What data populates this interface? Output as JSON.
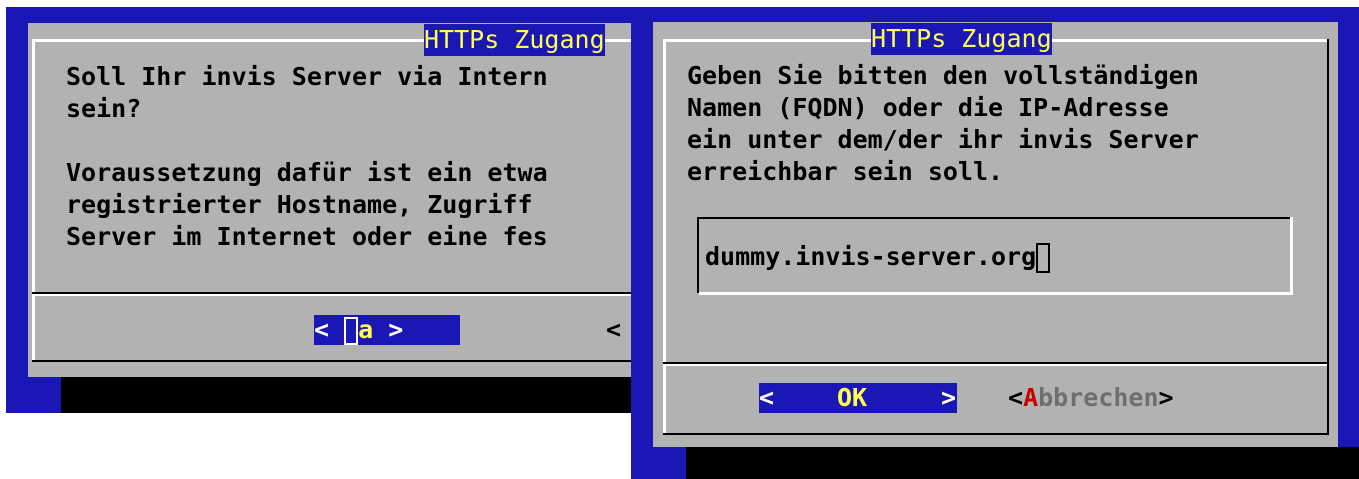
{
  "left_dialog": {
    "title": "HTTPs Zugang",
    "lines": [
      "Soll Ihr invis Server via Intern",
      "sein?",
      "",
      "Voraussetzung dafür ist ein etwa",
      "registrierter Hostname, Zugriff ",
      "Server im Internet oder eine fes"
    ],
    "yes_button": {
      "left": "< ",
      "hot": "J",
      "rest": "a",
      "right": " >"
    },
    "no_button_fragment": "<"
  },
  "right_dialog": {
    "title": "HTTPs Zugang",
    "lines": [
      "Geben Sie bitten den vollständigen",
      "Namen (FQDN) oder die IP-Adresse",
      "ein unter dem/der ihr invis Server",
      "erreichbar sein soll."
    ],
    "input_value": "dummy.invis-server.org",
    "ok_button": {
      "left": "<",
      "label": "OK",
      "right": ">"
    },
    "cancel_button": {
      "left": "<",
      "hot": "A",
      "rest": "bbrechen",
      "right": ">"
    }
  },
  "colors": {
    "background_blue": "#1a17b4",
    "dialog_gray": "#b2b2b2",
    "title_yellow": "#ffff50",
    "hotkey_red": "#c80000"
  }
}
